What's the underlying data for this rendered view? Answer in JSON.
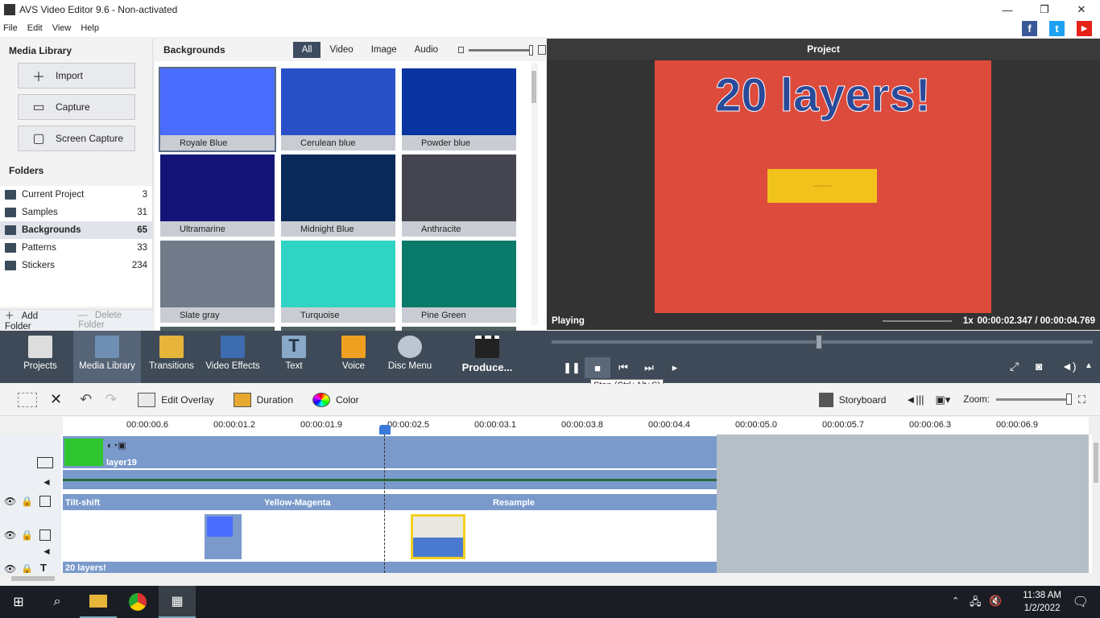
{
  "window": {
    "title": "AVS Video Editor 9.6 - Non-activated"
  },
  "menu": [
    "File",
    "Edit",
    "View",
    "Help"
  ],
  "social": [
    "f",
    "t",
    "▶"
  ],
  "library": {
    "title": "Media Library",
    "buttons": [
      "Import",
      "Capture",
      "Screen Capture"
    ],
    "folders_title": "Folders",
    "folders": [
      {
        "name": "Current Project",
        "count": "3"
      },
      {
        "name": "Samples",
        "count": "31"
      },
      {
        "name": "Backgrounds",
        "count": "65"
      },
      {
        "name": "Patterns",
        "count": "33"
      },
      {
        "name": "Stickers",
        "count": "234"
      }
    ],
    "add_folder": "Add Folder",
    "delete_folder": "Delete Folder"
  },
  "backgrounds": {
    "title": "Backgrounds",
    "tabs": [
      "All",
      "Video",
      "Image",
      "Audio"
    ],
    "items": [
      {
        "label": "Royale Blue",
        "color": "#4a6cff"
      },
      {
        "label": "Cerulean blue",
        "color": "#2a50c8"
      },
      {
        "label": "Powder blue",
        "color": "#0a34a0"
      },
      {
        "label": "Ultramarine",
        "color": "#141478"
      },
      {
        "label": "Midnight Blue",
        "color": "#0a2a5a"
      },
      {
        "label": "Anthracite",
        "color": "#45454f"
      },
      {
        "label": "Slate gray",
        "color": "#707a88"
      },
      {
        "label": "Turquoise",
        "color": "#30d4c4"
      },
      {
        "label": "Pine Green",
        "color": "#0a7a6a"
      }
    ]
  },
  "preview": {
    "title": "Project",
    "overlay_text": "20 layers!",
    "status": "Playing",
    "speed": "1x",
    "time": "00:00:02.347 / 00:00:04.769"
  },
  "toolbar": {
    "items": [
      "Projects",
      "Media Library",
      "Transitions",
      "Video Effects",
      "Text",
      "Voice",
      "Disc Menu",
      "Produce..."
    ],
    "tooltip": "Stop (Ctrl+Alt+S)"
  },
  "timeline_toolbar": {
    "edit_overlay": "Edit Overlay",
    "duration": "Duration",
    "color": "Color",
    "storyboard": "Storyboard",
    "zoom": "Zoom:"
  },
  "ruler": [
    "00:00:00.6",
    "00:00:01.2",
    "00:00:01.9",
    "00:00:02.5",
    "00:00:03.1",
    "00:00:03.8",
    "00:00:04.4",
    "00:00:05.0",
    "00:00:05.7",
    "00:00:06.3",
    "00:00:06.9"
  ],
  "tracks": {
    "video_clip": "layer19",
    "effects": [
      "Tilt-shift",
      "Yellow-Magenta",
      "Resample"
    ],
    "text_clip": "20 layers!"
  },
  "taskbar": {
    "time": "11:38 AM",
    "date": "1/2/2022"
  }
}
